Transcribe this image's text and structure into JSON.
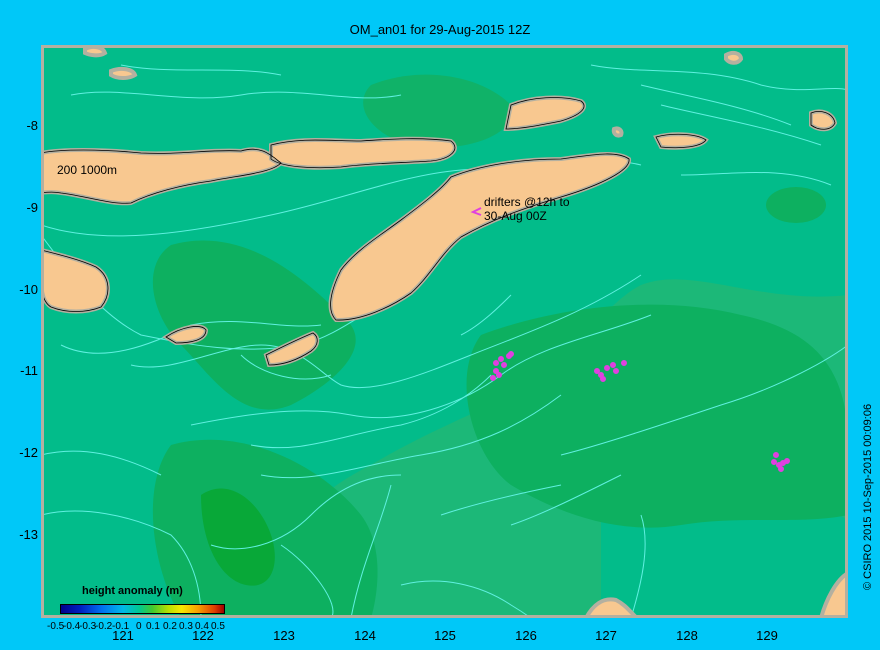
{
  "title": "OM_an01 for 29-Aug-2015 12Z",
  "axes": {
    "y_ticks": [
      "-8",
      "-9",
      "-10",
      "-11",
      "-12",
      "-13"
    ],
    "x_ticks": [
      "121",
      "122",
      "123",
      "124",
      "125",
      "126",
      "127",
      "128",
      "129"
    ]
  },
  "annotations": {
    "contour_label": "200  1000m",
    "drifters_line1": "drifters @12h to",
    "drifters_line2": "30-Aug 00Z"
  },
  "colorbar": {
    "title": "height anomaly  (m)",
    "labels": [
      "-0.5",
      "-0.4",
      "-0.3",
      "-0.2",
      "-0.1",
      "0",
      "0.1",
      "0.2",
      "0.3",
      "0.4",
      "0.5"
    ]
  },
  "credit": "© CSIRO 2015   10-Sep-2015 00:09:06",
  "colors": {
    "background": "#00c8f8",
    "field_low": "#00b890",
    "field_high": "#06b050",
    "land": "#f8c890",
    "shelf": "#b4b0a0",
    "contour": "#60f0e0",
    "drifter": "#e040e0"
  }
}
